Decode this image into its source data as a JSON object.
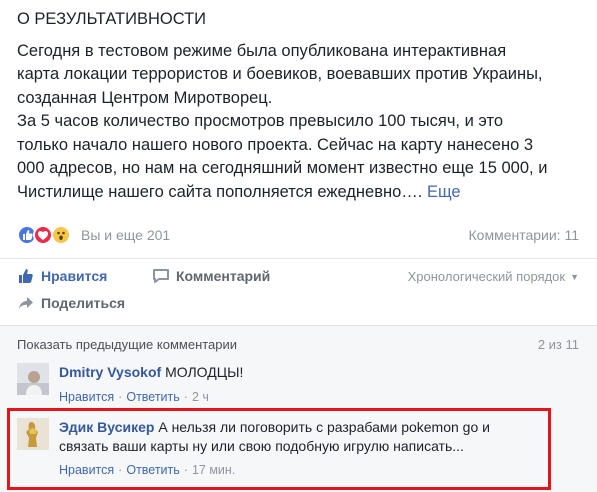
{
  "post": {
    "heading": "О РЕЗУЛЬТАТИВНОСТИ",
    "lines": [
      "Сегодня в тестовом режиме была опубликована интерактивная",
      "карта локации террористов и боевиков, воевавших против Украины,",
      "созданная Центром Миротворец.",
      "За 5 часов количество просмотров превысило 100 тысяч, и это",
      "только начало нашего нового проекта. Сейчас на карту нанесено 3",
      "000 адресов, но нам на сегодняшний момент известно еще 15 000, и",
      "Чистилище нашего сайта пополняется ежедневно…."
    ],
    "see_more": "Еще"
  },
  "reactions": {
    "icons": [
      "like-icon",
      "love-icon",
      "wow-icon"
    ],
    "summary": "Вы и еще 201",
    "comments_count": "Комментарии: 11"
  },
  "actions": {
    "like": "Нравится",
    "comment": "Комментарий",
    "share": "Поделиться",
    "sort": "Хронологический порядок"
  },
  "comments": {
    "show_previous": "Показать предыдущие комментарии",
    "counter": "2 из 11",
    "items": [
      {
        "author": "Dmitry Vysokof",
        "text": "МОЛОДЦЫ!",
        "like": "Нравится",
        "reply": "Ответить",
        "time": "2 ч"
      },
      {
        "author": "Эдик Вусикер",
        "text": "А нельзя ли поговорить с разрабами pokemon go и",
        "text2": "связать ваши карты ну или свою подобную игрулю написать...",
        "like": "Нравится",
        "reply": "Ответить",
        "time": "17 мин."
      }
    ]
  },
  "colors": {
    "link": "#4267b2",
    "author": "#365899",
    "highlight": "#e5141b"
  }
}
